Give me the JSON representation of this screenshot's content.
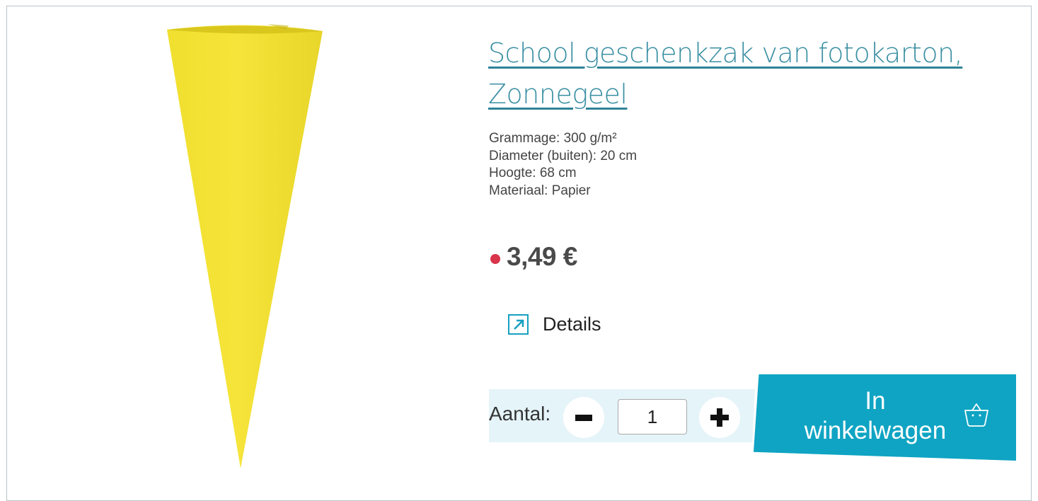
{
  "product": {
    "title_line1": "School geschenkzak van fotokarton,",
    "title_line2": "Zonnegeel",
    "image_color": "#f2e23a"
  },
  "specs": [
    "Grammage: 300 g/m²",
    "Diameter (buiten): 20 cm",
    "Hoogte: 68 cm",
    "Materiaal: Papier"
  ],
  "price": {
    "value": "3,49 €",
    "indicator_color": "#d8344a"
  },
  "details": {
    "label": "Details",
    "icon": "external-link-icon"
  },
  "quantity": {
    "label": "Aantal:",
    "value": "1",
    "decrease_icon": "minus-icon",
    "increase_icon": "plus-icon"
  },
  "cart": {
    "label_line1": "In",
    "label_line2": "winkelwagen",
    "icon": "basket-icon",
    "color": "#0fa4c3"
  }
}
